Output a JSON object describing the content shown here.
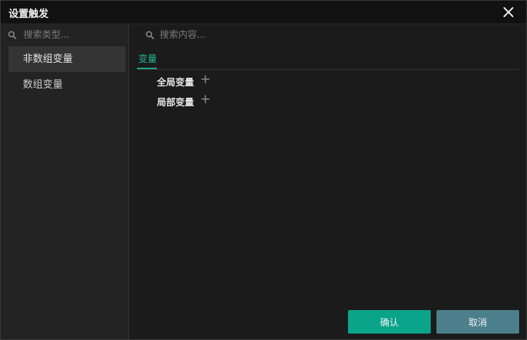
{
  "window": {
    "title": "设置触发"
  },
  "sidebar": {
    "search_placeholder": "搜索类型...",
    "items": [
      {
        "label": "非数组变量",
        "active": true
      },
      {
        "label": "数组变量",
        "active": false
      }
    ]
  },
  "main": {
    "search_placeholder": "搜索内容...",
    "tabs": [
      {
        "label": "变量",
        "active": true
      }
    ],
    "groups": [
      {
        "label": "全局变量"
      },
      {
        "label": "局部变量"
      }
    ]
  },
  "footer": {
    "confirm_label": "确认",
    "cancel_label": "取消"
  },
  "colors": {
    "accent": "#1ea88a",
    "confirm": "#0aa48a",
    "cancel": "#4b7f8c"
  },
  "icons": {
    "close": "close-icon",
    "search": "search-icon",
    "add": "plus-icon"
  }
}
